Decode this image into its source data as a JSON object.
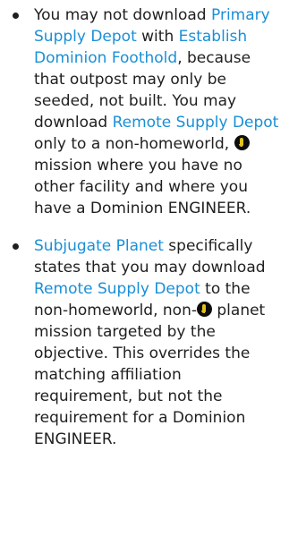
{
  "rules": {
    "item1": {
      "t1": "You may not download ",
      "link_primary_supply_depot": "Primary Supply Depot",
      "t2": " with ",
      "link_establish_dominion_foothold": "Establish Dominion Foothold",
      "t3": ", because that outpost may only be seeded, not built. You may download ",
      "link_remote_supply_depot": "Remote Supply Depot",
      "t4": " only to a non-homeworld, ",
      "icon": "dominion-icon",
      "t5": " mission where you have no other facility and where you have a Dominion ENGINEER."
    },
    "item2": {
      "link_subjugate_planet": "Subjugate Planet",
      "t1": " specifically states that you may download ",
      "link_remote_supply_depot": "Remote Supply Depot",
      "t2": " to the non-homeworld, non-",
      "icon": "dominion-icon",
      "t3": " planet mission targeted by the objective. This overrides the matching affiliation requirement, but not the requirement for a Dominion ENGINEER."
    }
  },
  "colors": {
    "link": "#1a8fd6",
    "text": "#1f1f1f",
    "icon_fill": "#0d0d0d",
    "icon_glyph": "#e3c21a"
  }
}
